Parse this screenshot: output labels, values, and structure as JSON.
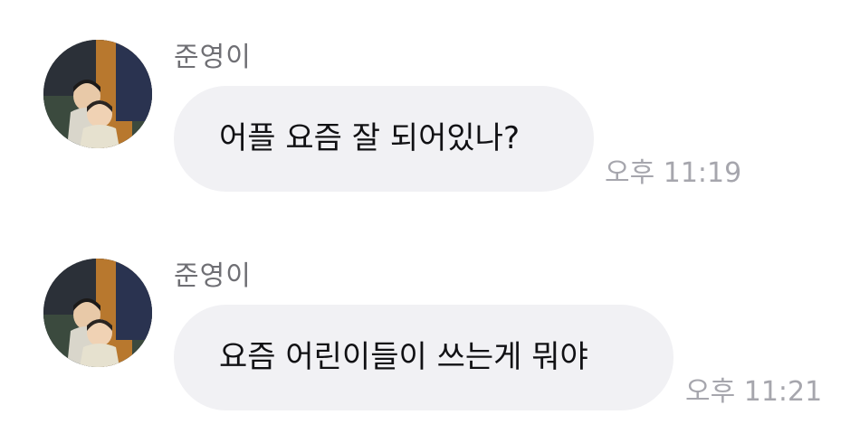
{
  "messages": [
    {
      "sender": "준영이",
      "text": "어플 요즘 잘 되어있나?",
      "time": "오후 11:19"
    },
    {
      "sender": "준영이",
      "text": "요즘 어린이들이 쓰는게 뭐야",
      "time": "오후 11:21"
    }
  ],
  "colors": {
    "bubble": "#f1f1f4",
    "sender": "#6f6f74",
    "timestamp": "#a6a6ad",
    "text": "#111114"
  }
}
